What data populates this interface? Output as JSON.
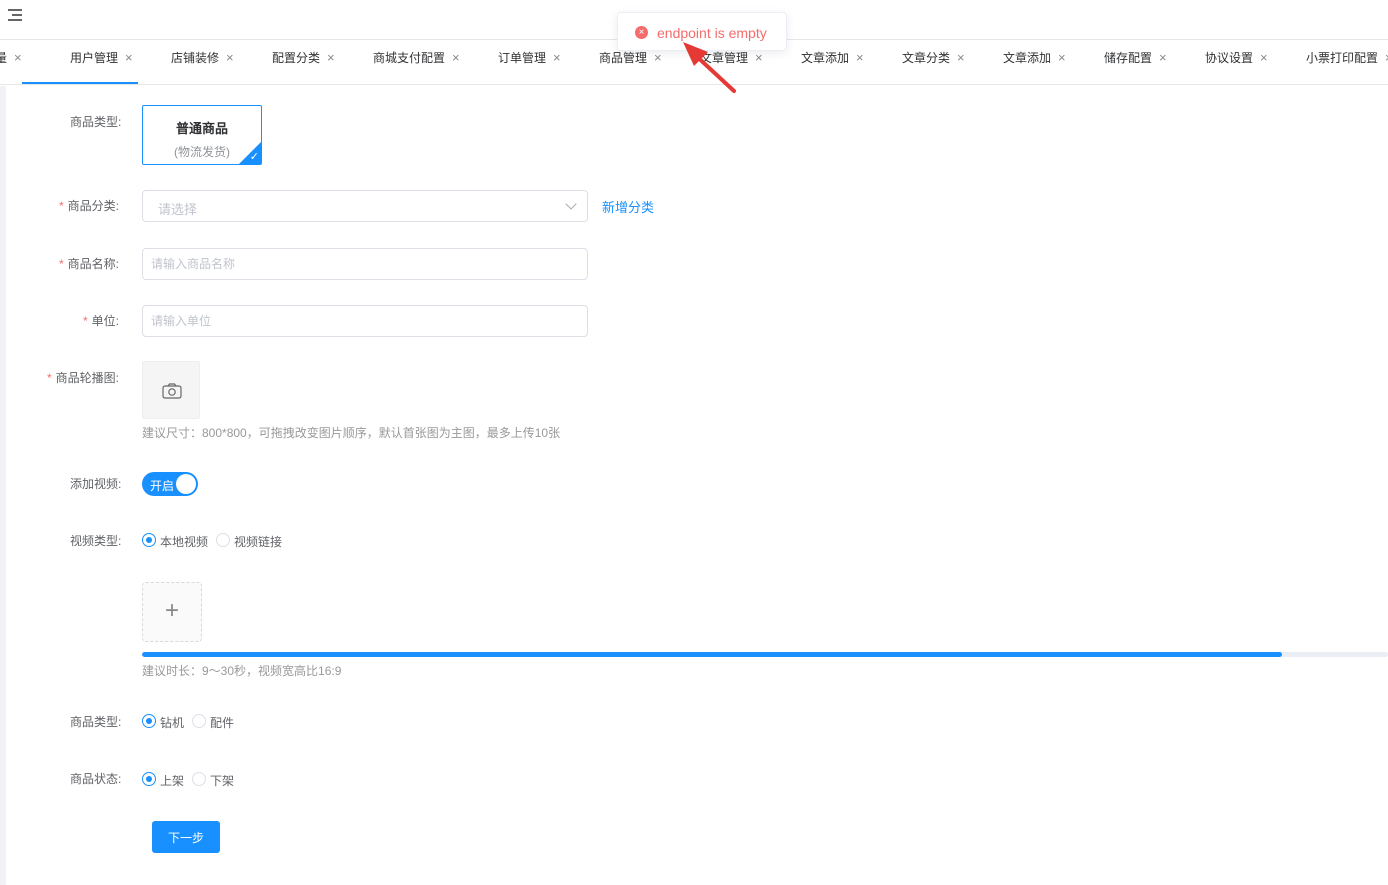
{
  "tabs": [
    {
      "label": "量",
      "close": "×"
    },
    {
      "label": "用户管理",
      "close": "×"
    },
    {
      "label": "店铺装修",
      "close": "×"
    },
    {
      "label": "配置分类",
      "close": "×"
    },
    {
      "label": "商城支付配置",
      "close": "×"
    },
    {
      "label": "订单管理",
      "close": "×"
    },
    {
      "label": "商品管理",
      "close": "×"
    },
    {
      "label": "文章管理",
      "close": "×"
    },
    {
      "label": "文章添加",
      "close": "×"
    },
    {
      "label": "文章分类",
      "close": "×"
    },
    {
      "label": "文章添加",
      "close": "×"
    },
    {
      "label": "储存配置",
      "close": "×"
    },
    {
      "label": "协议设置",
      "close": "×"
    },
    {
      "label": "小票打印配置",
      "close": "×"
    }
  ],
  "toast": {
    "message": "endpoint is empty",
    "icon": "×"
  },
  "form": {
    "product_type_label": "商品类型:",
    "type_card": {
      "title": "普通商品",
      "subtitle": "(物流发货)",
      "check": "✓"
    },
    "required_mark": "*",
    "category_label": "商品分类:",
    "category_placeholder": "请选择",
    "add_category_link": "新增分类",
    "name_label": "商品名称:",
    "name_placeholder": "请输入商品名称",
    "unit_label": "单位:",
    "unit_placeholder": "请输入单位",
    "carousel_label": "商品轮播图:",
    "carousel_tip": "建议尺寸：800*800，可拖拽改变图片顺序，默认首张图为主图，最多上传10张",
    "video_label": "添加视频:",
    "video_switch_text": "开启",
    "video_type_label": "视频类型:",
    "video_type_options": [
      "本地视频",
      "视频链接"
    ],
    "video_upload_plus": "+",
    "video_progress": 0.915,
    "video_tip": "建议时长：9～30秒，视频宽高比16:9",
    "product_kind_label": "商品类型:",
    "product_kind_options": [
      "钻机",
      "配件"
    ],
    "status_label": "商品状态:",
    "status_options": [
      "上架",
      "下架"
    ],
    "next_button": "下一步"
  }
}
